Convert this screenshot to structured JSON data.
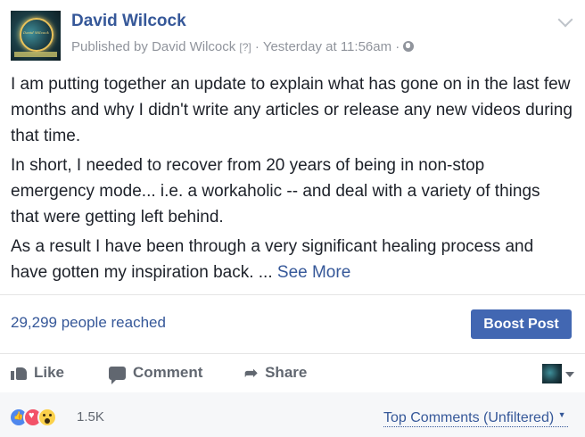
{
  "post": {
    "author": "David Wilcock",
    "published_by_prefix": "Published by ",
    "published_by_name": "David Wilcock",
    "help_marker": "[?]",
    "separator": " · ",
    "timestamp": "Yesterday at 11:56am",
    "paragraphs": [
      "I am putting together an update to explain what has gone on in the last few months and why I didn't write any articles or release any new videos during that time.",
      "In short, I needed to recover from 20 years of being in non-stop emergency mode... i.e. a workaholic -- and deal with a variety of things that were getting left behind.",
      "As a result I have been through a very significant healing process and have gotten my inspiration back. ..."
    ],
    "see_more": "See More",
    "avatar_logo_text": "David Wilcock"
  },
  "insights": {
    "reach_text": "29,299 people reached",
    "boost_label": "Boost Post"
  },
  "actions": {
    "like": "Like",
    "comment": "Comment",
    "share": "Share"
  },
  "reactions": {
    "types": [
      "like",
      "love",
      "wow"
    ],
    "count": "1.5K"
  },
  "comments": {
    "filter_label": "Top Comments (Unfiltered)"
  },
  "colors": {
    "link_blue": "#365899",
    "boost_button_bg": "#4267b2",
    "meta_gray": "#90949c",
    "action_gray": "#616770",
    "reactions_bg": "#f6f7f9"
  }
}
